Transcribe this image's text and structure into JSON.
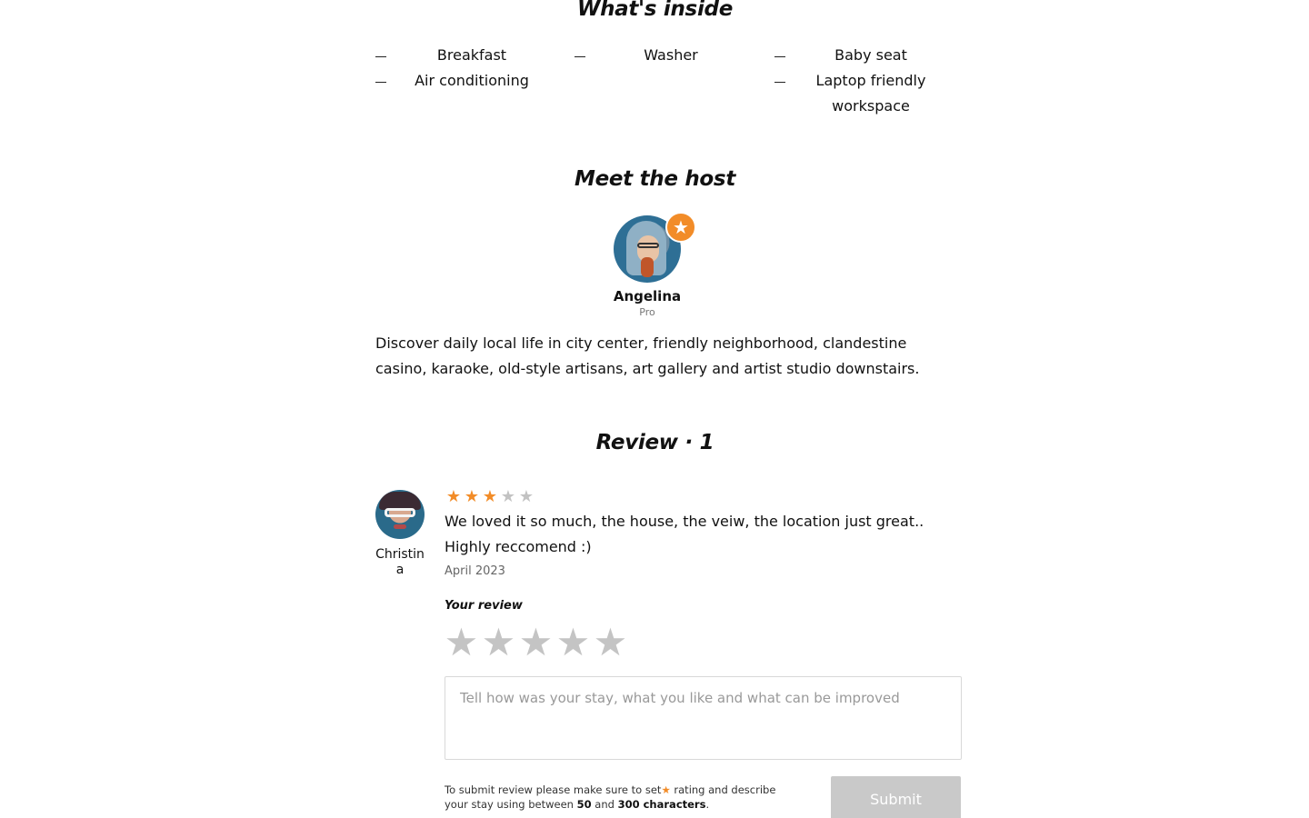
{
  "inside": {
    "title": "What's inside",
    "columns": [
      [
        "Breakfast",
        "Air conditioning"
      ],
      [
        "Washer"
      ],
      [
        "Baby seat",
        "Laptop friendly workspace"
      ]
    ]
  },
  "host": {
    "title": "Meet the host",
    "name": "Angelina",
    "level": "Pro",
    "badge_icon": "star-icon",
    "description": "Discover daily local life in city center, friendly neighborhood, clandestine casino, karaoke, old-style artisans, art gallery and artist studio downstairs."
  },
  "reviews": {
    "title": "Review · 1",
    "items": [
      {
        "author": "Christina",
        "rating": 3,
        "max_rating": 5,
        "text": "We loved it so much, the house, the veiw, the location just great.. Highly reccomend :)",
        "date": "April 2023"
      }
    ]
  },
  "your_review": {
    "label": "Your review",
    "rating": 0,
    "max_rating": 5,
    "placeholder": "Tell how was your stay, what you like and what can be improved",
    "hint_parts": {
      "a": "To submit review please make sure to set",
      "b": " rating and describe your stay using between ",
      "min": "50",
      "and": " and ",
      "max": "300 characters",
      "end": "."
    },
    "submit_label": "Submit"
  },
  "colors": {
    "accent": "#f28c28",
    "star_off": "#c2c2c2",
    "button_disabled": "#c9c9c9"
  }
}
